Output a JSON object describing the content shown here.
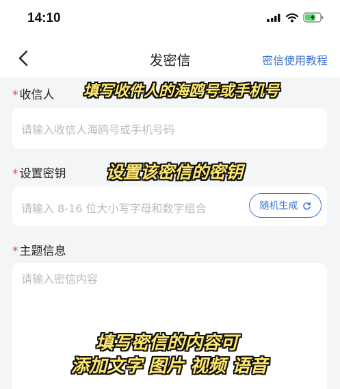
{
  "status_bar": {
    "time": "14:10"
  },
  "nav": {
    "title": "发密信",
    "right_link": "密信使用教程"
  },
  "fields": {
    "recipient": {
      "required_mark": "*",
      "label": "收信人",
      "placeholder": "请输入收信人海鸥号或手机号码"
    },
    "key": {
      "required_mark": "*",
      "label": "设置密钥",
      "placeholder": "请输入 8-16 位大小写字母和数字组合",
      "random_button": "随机生成"
    },
    "subject": {
      "required_mark": "*",
      "label": "主题信息",
      "placeholder": "请输入密信内容"
    }
  },
  "captions": {
    "recipient": "填写收件人的海鸥号或手机号",
    "key": "设置该密信的密钥",
    "content_line1": "填写密信的内容可",
    "content_line2": "添加文字 图片 视频 语音"
  },
  "colors": {
    "accent": "#3b73d1",
    "required": "#e5533b",
    "caption_fill": "#ffe86b",
    "battery": "#4cd964"
  }
}
